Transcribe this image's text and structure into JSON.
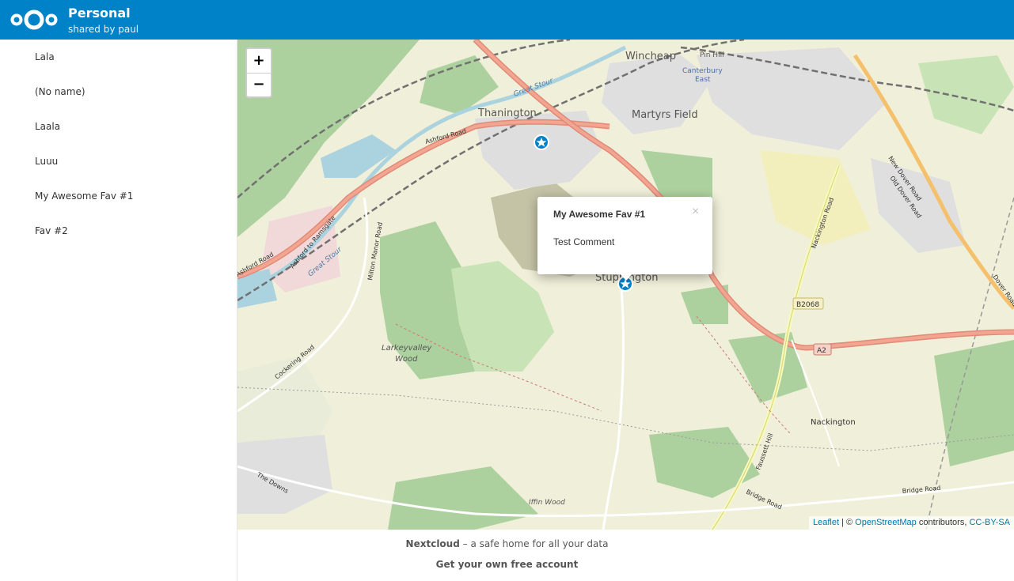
{
  "header": {
    "title": "Personal",
    "subtitle": "shared by paul",
    "brand_color": "#0082c9",
    "logo_icon": "nextcloud-logo-icon"
  },
  "sidebar": {
    "items": [
      {
        "label": "Lala"
      },
      {
        "label": "(No name)"
      },
      {
        "label": "Laala"
      },
      {
        "label": "Luuu"
      },
      {
        "label": "My Awesome Fav #1"
      },
      {
        "label": "Fav #2"
      }
    ]
  },
  "map": {
    "zoom_in": "+",
    "zoom_out": "−",
    "popup": {
      "title": "My Awesome Fav #1",
      "comment": "Test Comment",
      "close": "×"
    },
    "attribution": {
      "leaflet": "Leaflet",
      "sep": " | © ",
      "osm": "OpenStreetMap",
      "contributors": " contributors, ",
      "license": "CC-BY-SA"
    },
    "labels": {
      "wincheap": "Wincheap",
      "pin_hill": "Pin Hill",
      "canterbury_east_1": "Canterbury",
      "canterbury_east_2": "East",
      "thanington": "Thanington",
      "martyrs_field": "Martyrs Field",
      "ashford_road": "Ashford Road",
      "ashford_road_2": "Ashford Road",
      "great_stour": "Great Stour",
      "new_dover_road": "New Dover Road",
      "old_dover_road": "Old Dover Road",
      "dover_road": "Dover Road",
      "nackington_road": "Nackington Road",
      "b2068": "B2068",
      "a2": "A2",
      "milton_manor_road": "Milton Manor Road",
      "ashford_to_ramsgate": "Ashford to Ramsgate",
      "great_stour_2": "Great Stour",
      "larkeyvalley_1": "Larkeyvalley",
      "larkeyvalley_2": "Wood",
      "cockering_road": "Cockering Road",
      "stuppington": "Stuppington",
      "nackington": "Nackington",
      "faussett_hill": "Faussett Hill",
      "bridge_road": "Bridge Road",
      "bridge_road_2": "Bridge Road",
      "the_downs": "The Downs",
      "iffin_wood": "Iffin Wood",
      "winch": "Wincheap"
    },
    "marker_icon": "star-marker-icon"
  },
  "footer": {
    "brand": "Nextcloud",
    "tagline": " – a safe home for all your data",
    "cta": "Get your own free account"
  }
}
